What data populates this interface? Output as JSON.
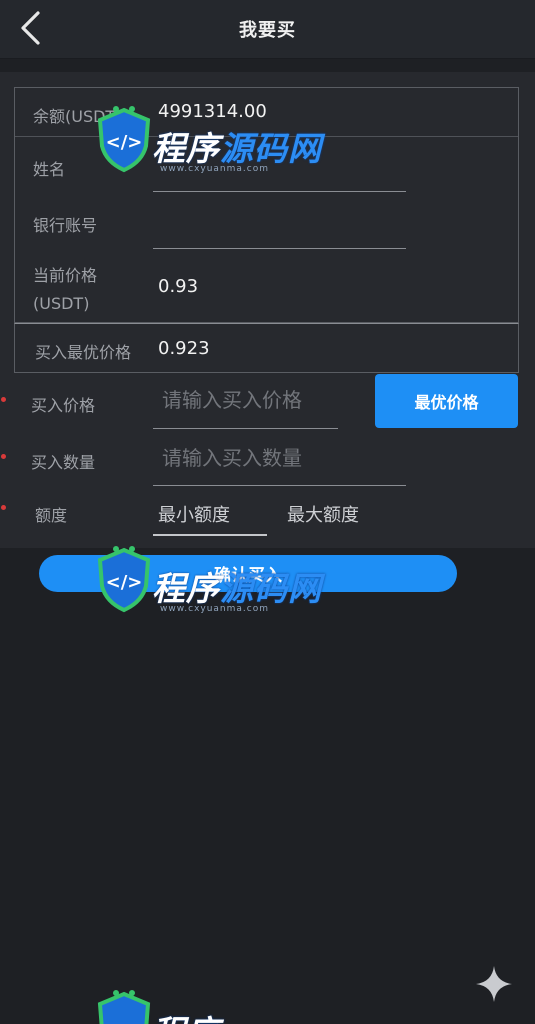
{
  "header": {
    "title": "我要买"
  },
  "form": {
    "balance_label": "余额(USDT)",
    "balance_value": "4991314.00",
    "name_label": "姓名",
    "name_value": "",
    "bank_label": "银行账号",
    "bank_value": "",
    "price_label_line1": "当前价格",
    "price_label_line2": "(USDT)",
    "price_value": "0.93",
    "best_label": "买入最优价格",
    "best_value": "0.923",
    "buy_price_label": "买入价格",
    "buy_price_placeholder": "请输入买入价格",
    "best_price_button": "最优价格",
    "quantity_label": "买入数量",
    "quantity_placeholder": "请输入买入数量",
    "amount_label": "额度",
    "amount_min": "最小额度",
    "amount_max": "最大额度"
  },
  "confirm_button": "确认买入",
  "watermark": {
    "text_white": "程序",
    "text_blue": "源码网",
    "url": "www.cxyuanma.com"
  },
  "colors": {
    "background": "#1e2024",
    "panel": "#27292e",
    "accent": "#1e8ff5",
    "required": "#d93a3a"
  }
}
